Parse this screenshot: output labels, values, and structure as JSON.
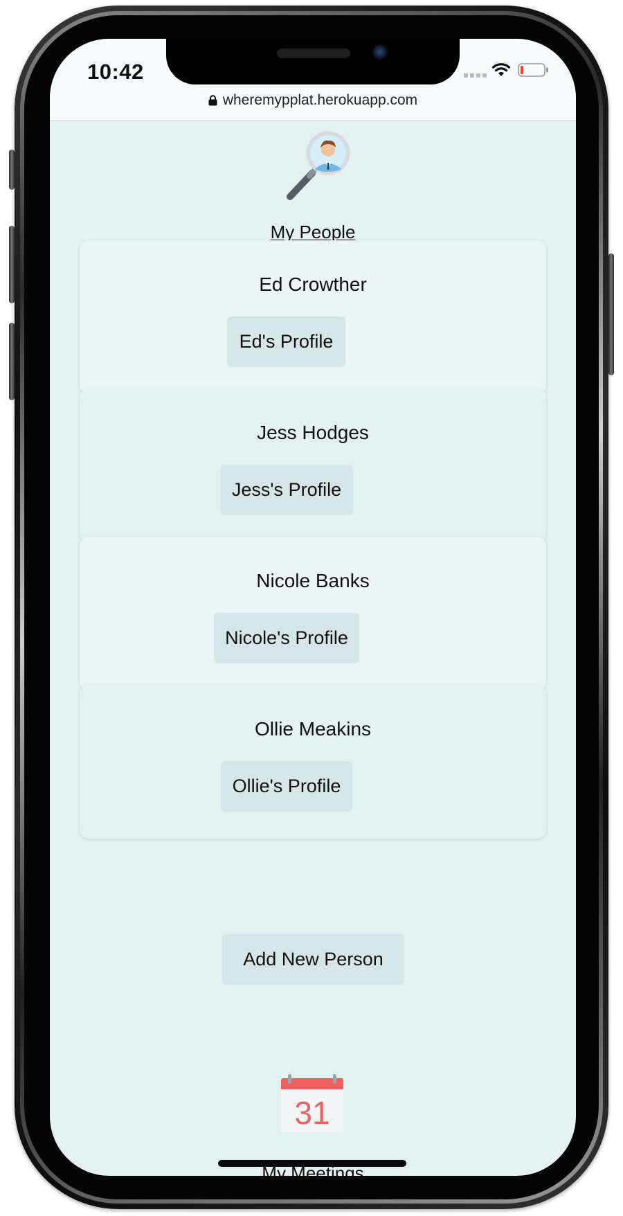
{
  "status_bar": {
    "time": "10:42",
    "url": "wheremypplat.herokuapp.com"
  },
  "page": {
    "title": "My People"
  },
  "people": [
    {
      "name": "Ed Crowther",
      "profile_label": "Ed's Profile"
    },
    {
      "name": "Jess Hodges",
      "profile_label": "Jess's Profile"
    },
    {
      "name": "Nicole Banks",
      "profile_label": "Nicole's Profile"
    },
    {
      "name": "Ollie Meakins",
      "profile_label": "Ollie's Profile"
    }
  ],
  "actions": {
    "add_person_label": "Add New Person"
  },
  "meetings": {
    "calendar_day": "31",
    "label": "My Meetings"
  },
  "icons": {
    "logo": "magnifier-person-icon",
    "calendar": "calendar-icon",
    "lock": "lock-icon",
    "wifi": "wifi-icon",
    "battery": "battery-low-icon"
  },
  "colors": {
    "page_background": "#e4f1f1",
    "card_background": "#ecf5f6",
    "button_background": "#d6e5e5",
    "calendar_red": "#f06060",
    "battery_low": "#ff3b30"
  }
}
